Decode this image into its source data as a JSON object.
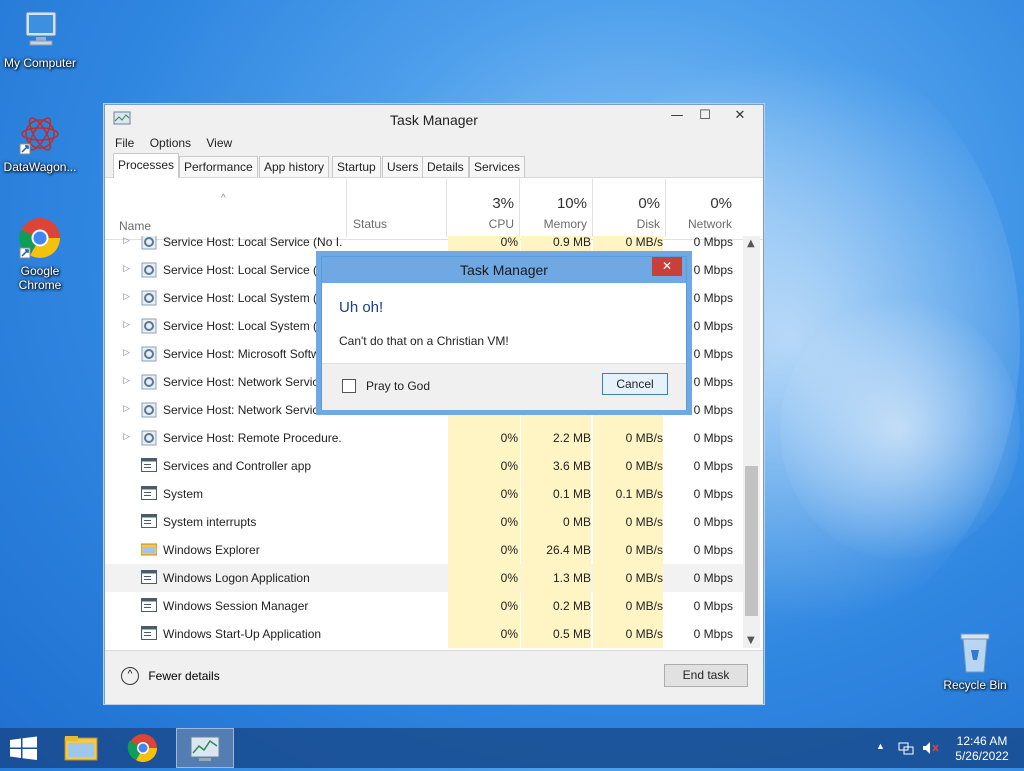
{
  "desktop": {
    "icons": {
      "my_computer": "My Computer",
      "datawagon": "DataWagon...",
      "chrome_line1": "Google",
      "chrome_line2": "Chrome",
      "recycle_bin": "Recycle Bin"
    }
  },
  "task_manager": {
    "title": "Task Manager",
    "menu": [
      "File",
      "Options",
      "View"
    ],
    "tabs": [
      "Processes",
      "Performance",
      "App history",
      "Startup",
      "Users",
      "Details",
      "Services"
    ],
    "active_tab": "Processes",
    "columns": {
      "name": "Name",
      "status": "Status",
      "cpu_pct": "3%",
      "cpu_label": "CPU",
      "mem_pct": "10%",
      "mem_label": "Memory",
      "disk_pct": "0%",
      "disk_label": "Disk",
      "net_pct": "0%",
      "net_label": "Network"
    },
    "rows": [
      {
        "name": "Service Host: Local Service (No I...",
        "cpu": "0%",
        "mem": "0.9 MB",
        "disk": "0 MB/s",
        "net": "0 Mbps"
      },
      {
        "name": "Service Host: Local Service (Ne",
        "cpu": "",
        "mem": "",
        "disk": "",
        "net": "0 Mbps"
      },
      {
        "name": "Service Host: Local System (14",
        "cpu": "",
        "mem": "",
        "disk": "",
        "net": "0 Mbps"
      },
      {
        "name": "Service Host: Local System (Ne",
        "cpu": "",
        "mem": "",
        "disk": "",
        "net": "0 Mbps"
      },
      {
        "name": "Service Host: Microsoft Softw",
        "cpu": "",
        "mem": "",
        "disk": "",
        "net": "0 Mbps"
      },
      {
        "name": "Service Host: Network Service",
        "cpu": "",
        "mem": "",
        "disk": "",
        "net": "0 Mbps"
      },
      {
        "name": "Service Host: Network Service",
        "cpu": "",
        "mem": "",
        "disk": "",
        "net": "0 Mbps"
      },
      {
        "name": "Service Host: Remote Procedure...",
        "cpu": "0%",
        "mem": "2.2 MB",
        "disk": "0 MB/s",
        "net": "0 Mbps"
      },
      {
        "name": "Services and Controller app",
        "cpu": "0%",
        "mem": "3.6 MB",
        "disk": "0 MB/s",
        "net": "0 Mbps"
      },
      {
        "name": "System",
        "cpu": "0%",
        "mem": "0.1 MB",
        "disk": "0.1 MB/s",
        "net": "0 Mbps"
      },
      {
        "name": "System interrupts",
        "cpu": "0%",
        "mem": "0 MB",
        "disk": "0 MB/s",
        "net": "0 Mbps"
      },
      {
        "name": "Windows Explorer",
        "cpu": "0%",
        "mem": "26.4 MB",
        "disk": "0 MB/s",
        "net": "0 Mbps"
      },
      {
        "name": "Windows Logon Application",
        "cpu": "0%",
        "mem": "1.3 MB",
        "disk": "0 MB/s",
        "net": "0 Mbps"
      },
      {
        "name": "Windows Session Manager",
        "cpu": "0%",
        "mem": "0.2 MB",
        "disk": "0 MB/s",
        "net": "0 Mbps"
      },
      {
        "name": "Windows Start-Up Application",
        "cpu": "0%",
        "mem": "0.5 MB",
        "disk": "0 MB/s",
        "net": "0 Mbps"
      }
    ],
    "fewer_details": "Fewer details",
    "end_task": "End task"
  },
  "dialog": {
    "title": "Task Manager",
    "heading": "Uh oh!",
    "message": "Can't do that on a Christian VM!",
    "checkbox_label": "Pray to God",
    "cancel": "Cancel",
    "close_glyph": "✕"
  },
  "taskbar": {
    "time": "12:46 AM",
    "date": "5/26/2022"
  }
}
